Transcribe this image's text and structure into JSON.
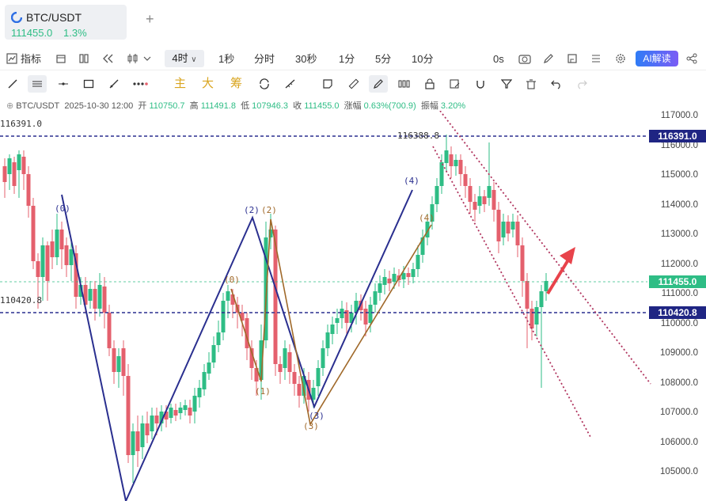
{
  "symbol_tab": {
    "name": "BTC/USDT",
    "price": "111455.0",
    "change": "1.3%",
    "add_icon": "plus-icon"
  },
  "toolbar1": {
    "indicators": "指标",
    "timeframes": [
      "1秒",
      "分时",
      "30秒",
      "1分",
      "5分",
      "10分"
    ],
    "active_timeframe": "4时",
    "countdown": "0s",
    "ai_button": "AI解读"
  },
  "toolbar2": {
    "main": "主",
    "big": "大",
    "chip": "筹"
  },
  "info": {
    "pair": "BTC/USDT",
    "time": "2025-10-30 12:00",
    "open_label": "开",
    "open": "110750.7",
    "high_label": "高",
    "high": "111491.8",
    "low_label": "低",
    "low": "107946.3",
    "close_label": "收",
    "close": "111455.0",
    "chg_label": "涨幅",
    "chg": "0.63%(700.9)",
    "amp_label": "振幅",
    "amp": "3.20%"
  },
  "axis": {
    "ticks": [
      "117000.0",
      "116000.0",
      "115000.0",
      "114000.0",
      "113000.0",
      "112000.0",
      "111000.0",
      "110000.0",
      "109000.0",
      "108000.0",
      "107000.0",
      "106000.0",
      "105000.0"
    ],
    "tag_high": "116391.0",
    "tag_last": "111455.0",
    "tag_mid": "110420.8"
  },
  "left_labels": {
    "high": "116391.0",
    "mid": "110420.8"
  },
  "annotations": {
    "peak_price": "116388.8",
    "wave_labels": [
      "(0)",
      "(2)",
      "(2)",
      "(0)",
      "(1)",
      "(3)",
      "(3)",
      "(4)",
      "(4)"
    ]
  },
  "colors": {
    "up": "#2ebd85",
    "down": "#e4606d",
    "wave": "#2a2f8f",
    "wave_alt": "#a0692a",
    "channel": "#b0345e",
    "arrow": "#e8434b"
  }
}
